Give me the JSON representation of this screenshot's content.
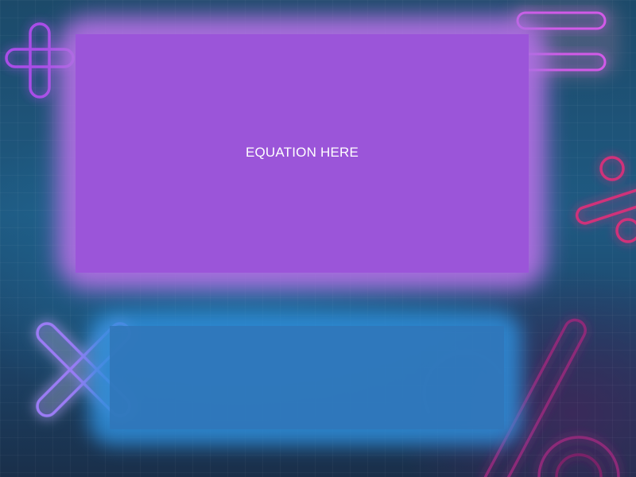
{
  "equation_panel": {
    "label": "EQUATION HERE"
  },
  "answer_panel": {
    "label": ""
  },
  "decorations": {
    "icons": [
      "plus-icon",
      "equals-icon",
      "percent-icon",
      "multiply-icon",
      "divide-icon"
    ]
  },
  "colors": {
    "background": "#1f5a82",
    "equation_panel": "#9b55d9",
    "equation_glow": "#b06fe2",
    "answer_panel": "#3076b8",
    "neon_purple": "#b05cf0",
    "neon_pink": "#d0307a",
    "neon_blue": "#8a7cf5"
  }
}
